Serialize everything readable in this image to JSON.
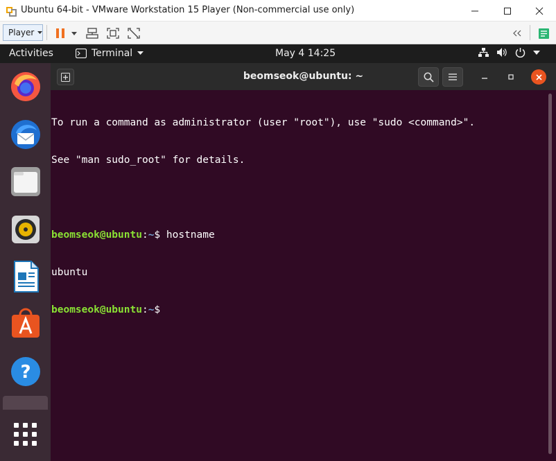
{
  "window": {
    "title": "Ubuntu 64-bit - VMware Workstation 15 Player (Non-commercial use only)"
  },
  "toolbar": {
    "player_label": "Player"
  },
  "topbar": {
    "activities": "Activities",
    "app_name": "Terminal",
    "clock": "May 4  14:25"
  },
  "dock": {
    "items": [
      "firefox-icon",
      "thunderbird-icon",
      "files-icon",
      "rhythmbox-icon",
      "libreoffice-writer-icon",
      "software-icon",
      "help-icon"
    ]
  },
  "terminal": {
    "title": "beomseok@ubuntu: ~",
    "banner_line1": "To run a command as administrator (user \"root\"), use \"sudo <command>\".",
    "banner_line2": "See \"man sudo_root\" for details.",
    "prompt_user": "beomseok@ubuntu",
    "prompt_sep": ":",
    "prompt_path": "~",
    "prompt_dollar": "$ ",
    "command1": "hostname",
    "output1": "ubuntu"
  },
  "colors": {
    "terminal_bg": "#300a24",
    "prompt_user": "#8ae234",
    "prompt_path": "#729fcf",
    "ubuntu_orange": "#e95420"
  }
}
